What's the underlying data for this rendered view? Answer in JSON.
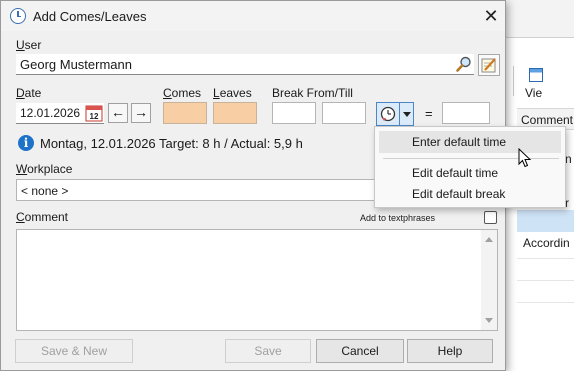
{
  "background_app": {
    "view_label": "Vie",
    "header_cell": "Comment",
    "row_fragment_1": "n",
    "row_fragment_2": "r",
    "row_text": "Accordin"
  },
  "dialog": {
    "title": "Add Comes/Leaves",
    "user": {
      "label_u": "U",
      "label_rest": "ser",
      "value": "Georg Mustermann"
    },
    "date": {
      "label_u": "D",
      "label_rest": "ate",
      "value": "12.01.2026",
      "calendar_day": "12"
    },
    "comes": {
      "label_u": "C",
      "label_rest": "omes",
      "value": ""
    },
    "leaves": {
      "label_u": "L",
      "label_rest": "eaves",
      "value": ""
    },
    "break": {
      "label": "Break From/Till",
      "from": "",
      "till": ""
    },
    "equals": "=",
    "total": "",
    "info_text": "Montag, 12.01.2026 Target: 8 h / Actual: 5,9 h",
    "workplace": {
      "label_u": "W",
      "label_rest": "orkplace",
      "value": "< none >"
    },
    "comment": {
      "label_u": "C",
      "label_rest": "omment",
      "value": "",
      "textphrases_label": "Add to textphrases"
    },
    "buttons": {
      "save_new": "Save & New",
      "save": "Save",
      "cancel": "Cancel",
      "help": "Help"
    }
  },
  "menu": {
    "items": [
      "Enter default time",
      "Edit default time",
      "Edit default break"
    ]
  },
  "colors": {
    "orange_field": "#f8cfa4",
    "info_blue": "#1e73c8",
    "accent": "#2a6ab0"
  }
}
